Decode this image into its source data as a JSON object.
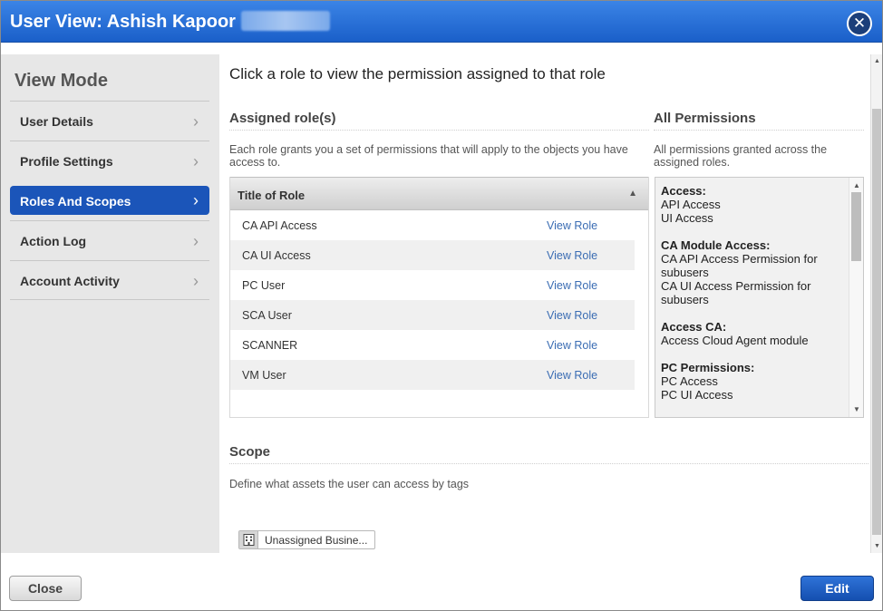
{
  "window": {
    "title": "User View: Ashish Kapoor",
    "close_icon": "close-icon"
  },
  "sidebar": {
    "heading": "View Mode",
    "items": [
      {
        "label": "User Details",
        "active": false
      },
      {
        "label": "Profile Settings",
        "active": false
      },
      {
        "label": "Roles And Scopes",
        "active": true
      },
      {
        "label": "Action Log",
        "active": false
      },
      {
        "label": "Account Activity",
        "active": false
      }
    ]
  },
  "main": {
    "heading": "Click a role to view the permission assigned to that role",
    "assigned_roles": {
      "title": "Assigned role(s)",
      "description": "Each role grants you a set of permissions that will apply to the objects you have access to.",
      "column_header": "Title of Role",
      "rows": [
        {
          "name": "CA API Access",
          "action": "View Role"
        },
        {
          "name": "CA UI Access",
          "action": "View Role"
        },
        {
          "name": "PC User",
          "action": "View Role"
        },
        {
          "name": "SCA User",
          "action": "View Role"
        },
        {
          "name": "SCANNER",
          "action": "View Role"
        },
        {
          "name": "VM User",
          "action": "View Role"
        }
      ]
    },
    "all_permissions": {
      "title": "All Permissions",
      "description": "All permissions granted across the assigned roles.",
      "groups": [
        {
          "title": "Access:",
          "items": [
            "API Access",
            "UI Access"
          ]
        },
        {
          "title": "CA Module Access:",
          "items": [
            "CA API Access Permission for subusers",
            "CA UI Access Permission for subusers"
          ]
        },
        {
          "title": "Access CA:",
          "items": [
            "Access Cloud Agent module"
          ]
        },
        {
          "title": "PC Permissions:",
          "items": [
            "PC Access",
            "PC UI Access"
          ]
        }
      ]
    },
    "scope": {
      "title": "Scope",
      "description": "Define what assets the user can access by tags",
      "tag_label": "Unassigned Busine...",
      "tag_icon": "building-icon"
    }
  },
  "footer": {
    "close_label": "Close",
    "edit_label": "Edit"
  },
  "colors": {
    "title_bar": "#1a5fc9",
    "active_nav": "#1b55b9",
    "link": "#3a6cb3",
    "edit_button": "#154fb0"
  }
}
